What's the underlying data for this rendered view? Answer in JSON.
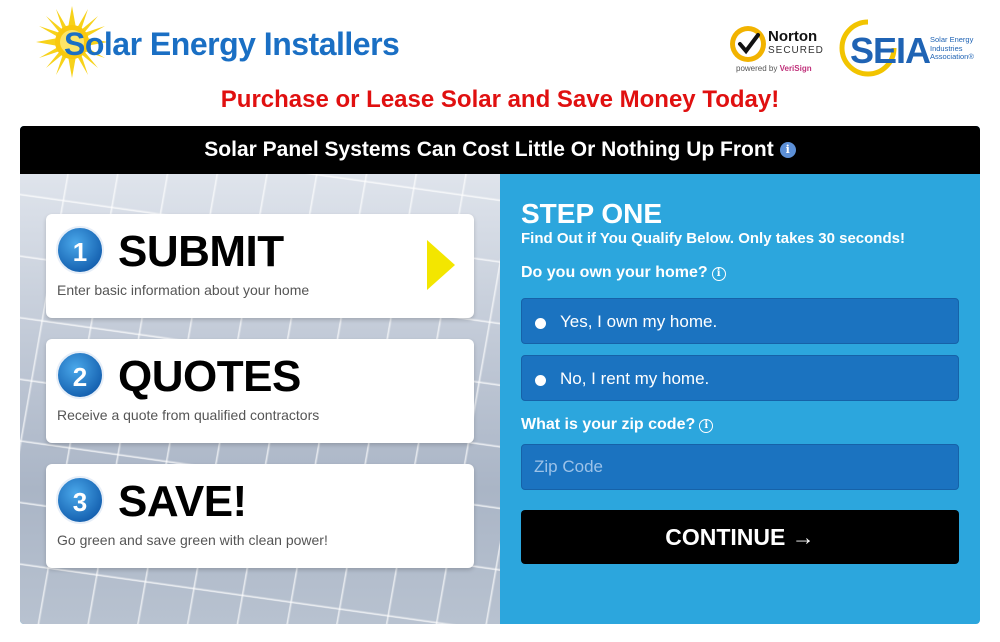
{
  "header": {
    "logo": {
      "text": "Solar Energy Installers",
      "icon": "sun-icon"
    },
    "norton": {
      "brand": "Norton",
      "secured": "SECURED",
      "powered_by": "powered by",
      "powered_brand": "VeriSign"
    },
    "seia": {
      "text": "SEIA",
      "subtext": "Solar Energy Industries Association®"
    },
    "headline": "Purchase or Lease Solar and Save Money Today!"
  },
  "panel": {
    "bar_title": "Solar Panel Systems Can Cost Little Or Nothing Up Front",
    "info_glyph": "i",
    "steps": [
      {
        "number": "1",
        "title": "SUBMIT",
        "description": "Enter basic information about your home"
      },
      {
        "number": "2",
        "title": "QUOTES",
        "description": "Receive a quote from qualified contractors"
      },
      {
        "number": "3",
        "title": "SAVE!",
        "description": "Go green and save green with clean power!"
      }
    ]
  },
  "form": {
    "step_title": "STEP ONE",
    "step_subtitle": "Find Out if You Qualify Below. Only takes 30 seconds!",
    "own_question": "Do you own your home?",
    "options": [
      {
        "label": "Yes, I own my home."
      },
      {
        "label": "No, I rent my home."
      }
    ],
    "zip_question": "What is your zip code?",
    "zip_placeholder": "Zip Code",
    "info_glyph": "i",
    "continue_label": "CONTINUE →"
  },
  "colors": {
    "headline": "#e01010",
    "form_bg": "#2ca6dd",
    "input_bg": "#1b73c0",
    "bar_bg": "#000000",
    "arrow": "#f3e600",
    "logo_blue": "#1a6fc4"
  }
}
